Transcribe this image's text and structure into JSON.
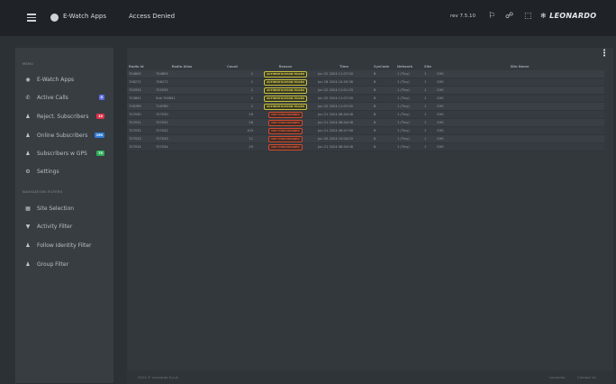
{
  "topbar": {
    "app_title": "E-Watch Apps",
    "page_title": "Access Denied",
    "revision": "rev 7.5.10",
    "brand": "LEONARDO",
    "icons": [
      "bell-icon",
      "link-icon",
      "fullscreen-icon"
    ]
  },
  "sidebar": {
    "menu_label": "MENU",
    "items": [
      {
        "label": "E-Watch Apps",
        "icon": "app-icon"
      },
      {
        "label": "Active Calls",
        "icon": "phone-icon",
        "badge": "0",
        "badge_color": "#5b6ee8"
      },
      {
        "label": "Reject. Subscribers",
        "icon": "user-x-icon",
        "badge": "10",
        "badge_color": "#e0314a"
      },
      {
        "label": "Online Subscribers",
        "icon": "user-online-icon",
        "badge": "190",
        "badge_color": "#2f7bd6"
      },
      {
        "label": "Subscribers w GPS",
        "icon": "users-gps-icon",
        "badge": "75",
        "badge_color": "#2fae5a"
      },
      {
        "label": "Settings",
        "icon": "gear-icon"
      }
    ],
    "filters_label": "NAVIGATION FILTERS",
    "filters": [
      {
        "label": "Site Selection",
        "icon": "grid-icon"
      },
      {
        "label": "Activity Filter",
        "icon": "filter-icon"
      },
      {
        "label": "Follow Identity Filter",
        "icon": "follow-user-icon"
      },
      {
        "label": "Group Filter",
        "icon": "group-icon"
      }
    ]
  },
  "table": {
    "headers": [
      "Radio Id",
      "Radio Alias",
      "Count",
      "Reason",
      "Time",
      "SysCode",
      "Network",
      "Site",
      "Site Name"
    ],
    "rows": [
      [
        "704805",
        "704805",
        "1",
        "AUTHENTICATION FAILED",
        "Jun 22 2024 11:07:00",
        "8",
        "1 (Tiny)",
        "1",
        "CHS"
      ],
      [
        "706272",
        "706272",
        "1",
        "AUTHENTICATION FAILED",
        "Jun 18 2024 10:49:38",
        "8",
        "1 (Tiny)",
        "1",
        "CHS"
      ],
      [
        "702935",
        "702935",
        "1",
        "AUTHENTICATION FAILED",
        "Jun 22 2024 11:01:33",
        "8",
        "1 (Tiny)",
        "1",
        "CHS"
      ],
      [
        "704841",
        "Sub 704841",
        "1",
        "AUTHENTICATION FAILED",
        "Jun 22 2024 11:07:00",
        "8",
        "1 (Tiny)",
        "1",
        "CHS"
      ],
      [
        "716789",
        "716789",
        "1",
        "AUTHENTICATION FAILED",
        "Jun 22 2024 11:07:00",
        "8",
        "1 (Tiny)",
        "1",
        "CHS"
      ],
      [
        "707030",
        "707030",
        "29",
        "NOT PROVISIONED",
        "Jun 21 2024 08:44:08",
        "8",
        "1 (Tiny)",
        "1",
        "CHS"
      ],
      [
        "707031",
        "707031",
        "28",
        "NOT PROVISIONED",
        "Jun 21 2024 08:44:08",
        "8",
        "1 (Tiny)",
        "1",
        "CHS"
      ],
      [
        "707032",
        "707032",
        "103",
        "NOT PROVISIONED",
        "Jun 21 2024 08:47:58",
        "8",
        "1 (Tiny)",
        "1",
        "CHS"
      ],
      [
        "707033",
        "707033",
        "11",
        "NOT PROVISIONED",
        "Jun 20 2024 15:04:29",
        "8",
        "1 (Tiny)",
        "1",
        "CHS"
      ],
      [
        "707034",
        "707034",
        "29",
        "NOT PROVISIONED",
        "Jun 21 2024 08:44:08",
        "8",
        "1 (Tiny)",
        "1",
        "CHS"
      ]
    ]
  },
  "footer": {
    "copyright": "2024 © Leonardo S.p.A.",
    "link1": "Leonardo",
    "link2": "Contact Us"
  }
}
